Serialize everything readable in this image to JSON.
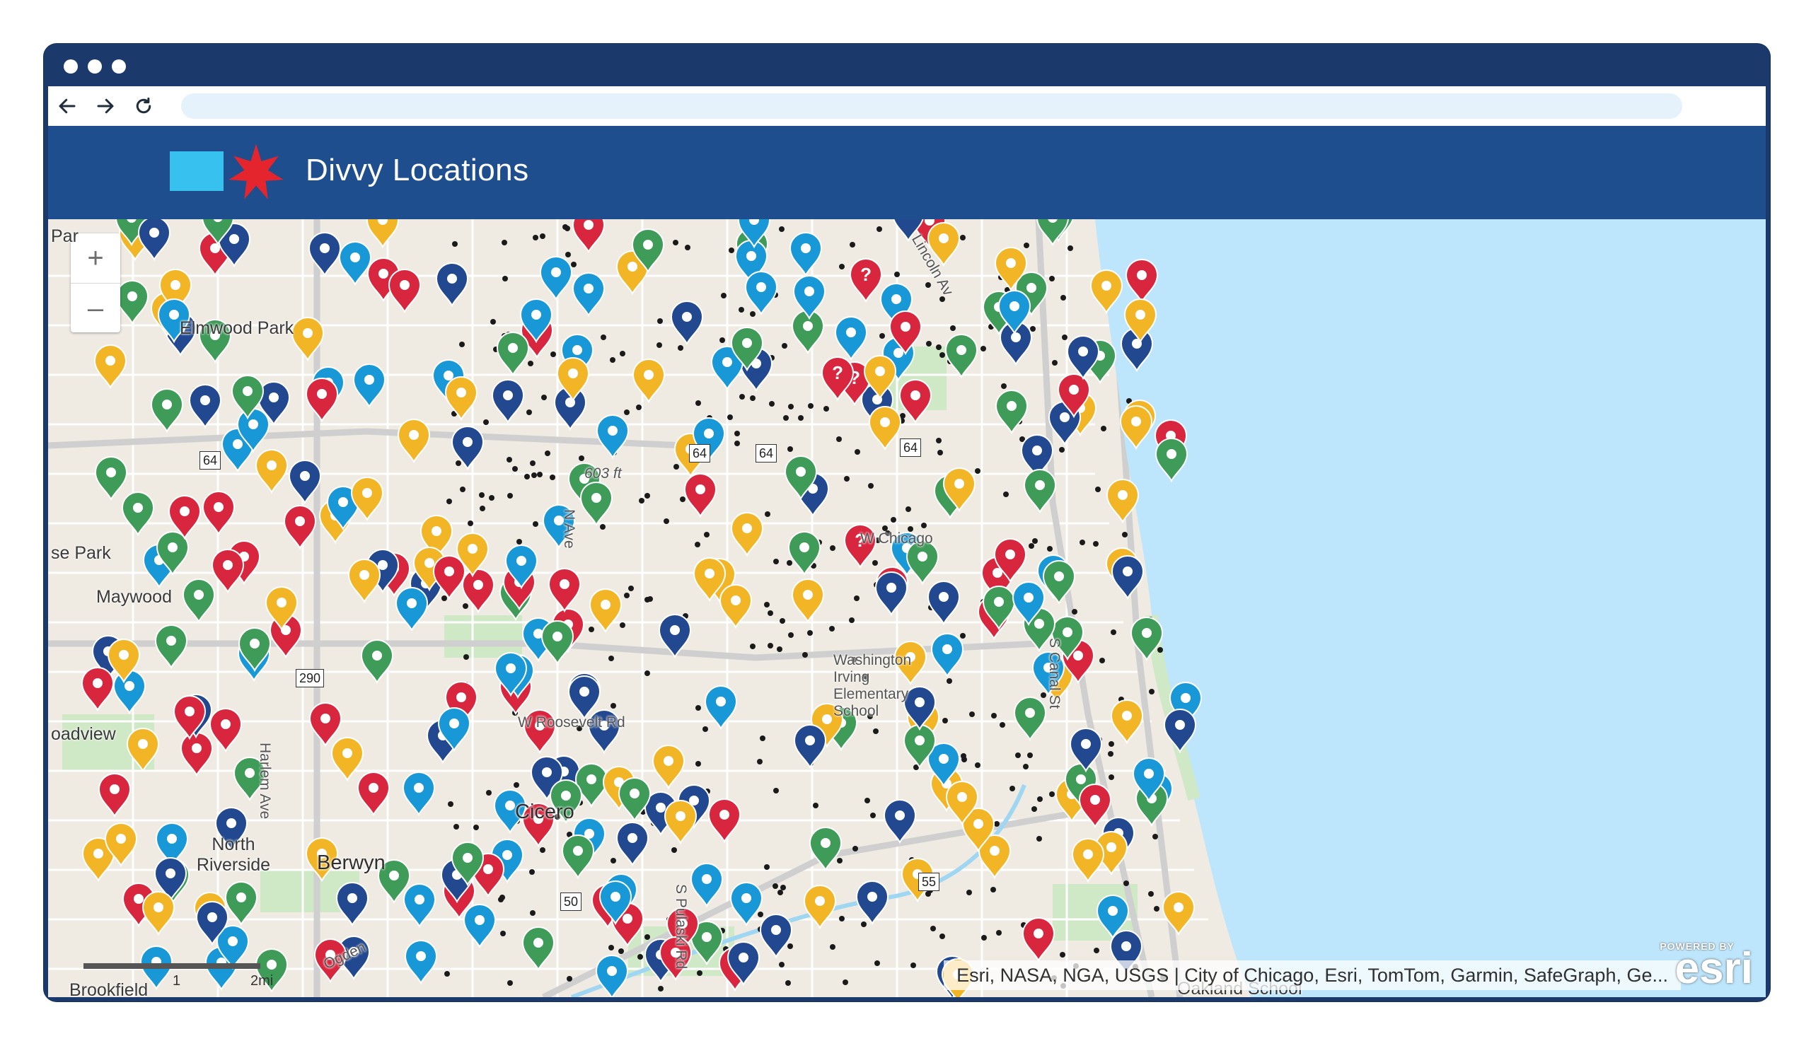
{
  "browser": {
    "window_dots": [
      "dot",
      "dot",
      "dot"
    ],
    "back_icon": "arrow-left-icon",
    "forward_icon": "arrow-right-icon",
    "reload_icon": "reload-icon"
  },
  "header": {
    "title": "Divvy Locations",
    "logo": "chicago-flag-logo",
    "colors": {
      "bar": "#1f4e8f",
      "flag_blue": "#36c1ef",
      "flag_star": "#e4252e"
    }
  },
  "map": {
    "zoom_in": "+",
    "zoom_out": "–",
    "colors": {
      "water": "#bde5fb",
      "land": "#efeae2",
      "park": "#cfe8c6"
    },
    "marker_colors": {
      "red": "#d8263e",
      "navy": "#22488f",
      "green": "#3e9b58",
      "yellow": "#f2b525",
      "blue": "#1898d6"
    },
    "places": {
      "elmwood_park": "Elmwood Park",
      "maywood": "Maywood",
      "melrose_park": "se Park",
      "broadview": "oadview",
      "cicero": "Cicero",
      "north_riverside": "North Riverside",
      "berwyn": "Berwyn",
      "brookfield": "Brookfield",
      "oakland_school": "Oakland School",
      "park_top": "Par",
      "roosevelt": "W Roosevelt Rd",
      "harlem": "Harlem Ave",
      "pulaski": "S Pulaski Rd",
      "canal": "S Canal St",
      "ogden": "Ogden",
      "elevation": "603 ft",
      "washington_irving": "Washington Irving Elementary School",
      "w_chicago": "W Chicago",
      "n_ave": "N Ave",
      "lincoln": "Lincoln Av"
    },
    "shields": [
      "64",
      "64",
      "64",
      "64",
      "50",
      "55",
      "290"
    ],
    "scale": {
      "a": "1",
      "b": "2mi"
    },
    "attribution": "Esri, NASA, NGA, USGS | City of Chicago, Esri, TomTom, Garmin, SafeGraph, Ge...",
    "esri": {
      "powered": "POWERED BY",
      "logo": "esri"
    }
  }
}
